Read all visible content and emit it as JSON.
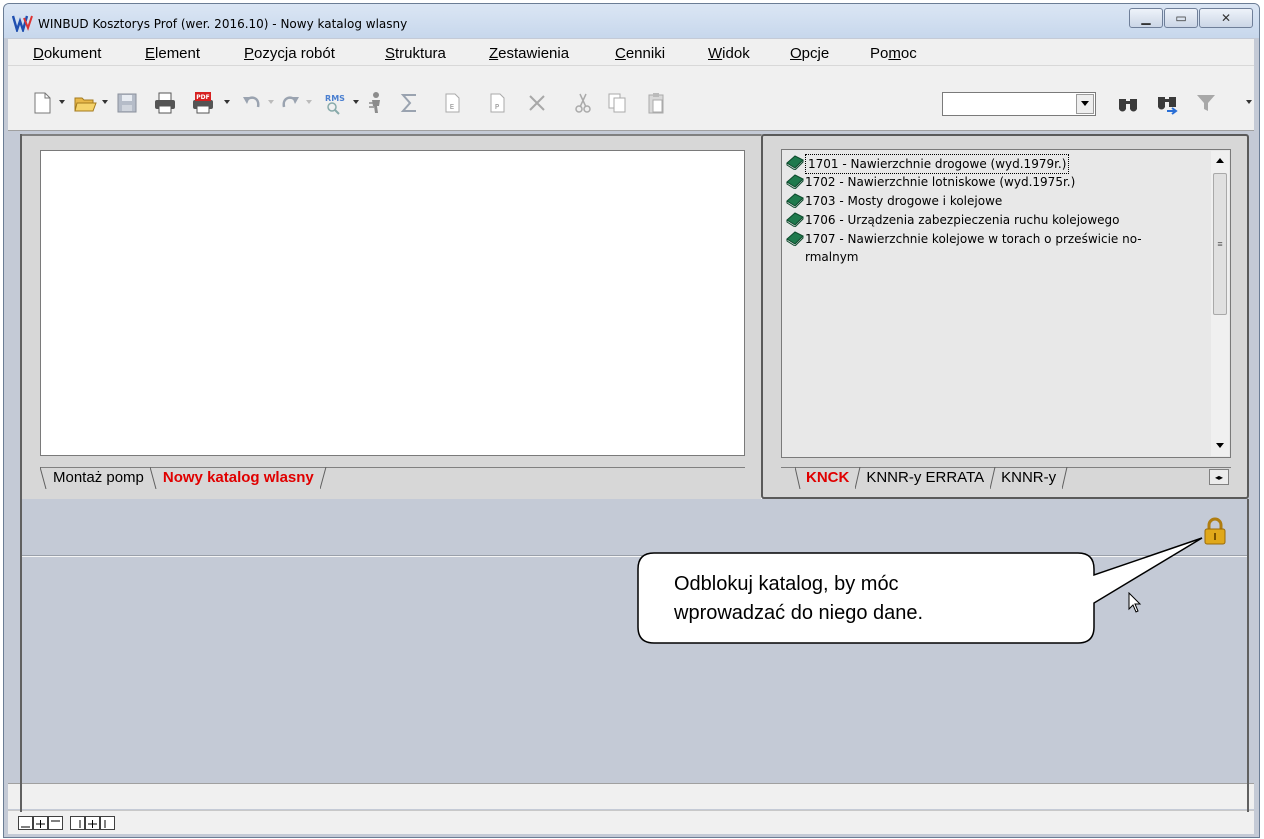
{
  "window": {
    "title": "WINBUD Kosztorys Prof (wer. 2016.10) - Nowy katalog wlasny",
    "controls": [
      "minimize",
      "maximize",
      "close"
    ]
  },
  "menu": [
    {
      "label": "Dokument",
      "ul": "D",
      "rest": "okument"
    },
    {
      "label": "Element",
      "ul": "E",
      "rest": "lement"
    },
    {
      "label": "Pozycja robót",
      "ul": "P",
      "rest": "ozycja robót"
    },
    {
      "label": "Struktura",
      "ul": "S",
      "rest": "truktura"
    },
    {
      "label": "Zestawienia",
      "ul": "Z",
      "rest": "estawienia"
    },
    {
      "label": "Cenniki",
      "ul": "C",
      "rest": "enniki"
    },
    {
      "label": "Widok",
      "ul": "W",
      "rest": "idok"
    },
    {
      "label": "Opcje",
      "ul": "O",
      "rest": "pcje"
    },
    {
      "label": "Pomoc",
      "pre": "Po",
      "ul": "m",
      "rest": "oc"
    }
  ],
  "toolbar": {
    "icons": [
      "new-document-icon",
      "open-folder-icon",
      "save-icon",
      "print-icon",
      "pdf-print-icon",
      "undo-icon",
      "redo-icon",
      "rms-icon",
      "worker-icon",
      "sum-icon",
      "e-icon",
      "p-icon",
      "delete-icon",
      "cut-icon",
      "copy-icon",
      "paste-icon",
      "binoculars-icon",
      "binoculars-next-icon",
      "filter-icon"
    ],
    "combo_value": ""
  },
  "left_panel": {
    "tabs": [
      "Montaż pomp",
      "Nowy katalog wlasny"
    ],
    "active_tab": "Nowy katalog wlasny"
  },
  "catalog_tree": {
    "items": [
      "1701 - Nawierzchnie drogowe (wyd.1979r.)",
      "1702 - Nawierzchnie lotniskowe (wyd.1975r.)",
      "1703 - Mosty drogowe i kolejowe",
      "1706 - Urządzenia zabezpieczenia ruchu kolejowego",
      "1707 - Nawierzchnie kolejowe w torach o prześwicie no-rmalnym"
    ],
    "tabs": [
      "KNCK",
      "KNNR-y ERRATA",
      "KNNR-y"
    ],
    "active_tab": "KNCK"
  },
  "callout": {
    "text": "Odblokuj katalog, by móc\nwprowadzać do niego dane."
  },
  "colors": {
    "accent_red": "#e00000",
    "book_green": "#1f7a4d",
    "lock_gold": "#e0a81a"
  }
}
